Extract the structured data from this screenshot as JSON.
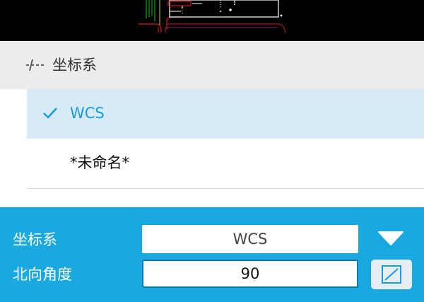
{
  "canvas": {
    "name": "cad-drawing-preview"
  },
  "panel": {
    "section_title": "坐标系",
    "section_icon": "axis-icon",
    "items": [
      {
        "label": "WCS",
        "selected": true,
        "icon": "checkmark-icon"
      },
      {
        "label": "*未命名*",
        "selected": false
      }
    ]
  },
  "properties": {
    "coord_label": "坐标系",
    "coord_value": "WCS",
    "coord_dropdown_icon": "triangle-down-icon",
    "north_label": "北向角度",
    "north_value": "90",
    "north_pick_icon": "pick-angle-icon"
  },
  "colors": {
    "accent_blue": "#19a9e1",
    "selected_row_bg": "#d7ebf7",
    "selected_text": "#1a9bd7",
    "header_bg": "#ededed"
  }
}
